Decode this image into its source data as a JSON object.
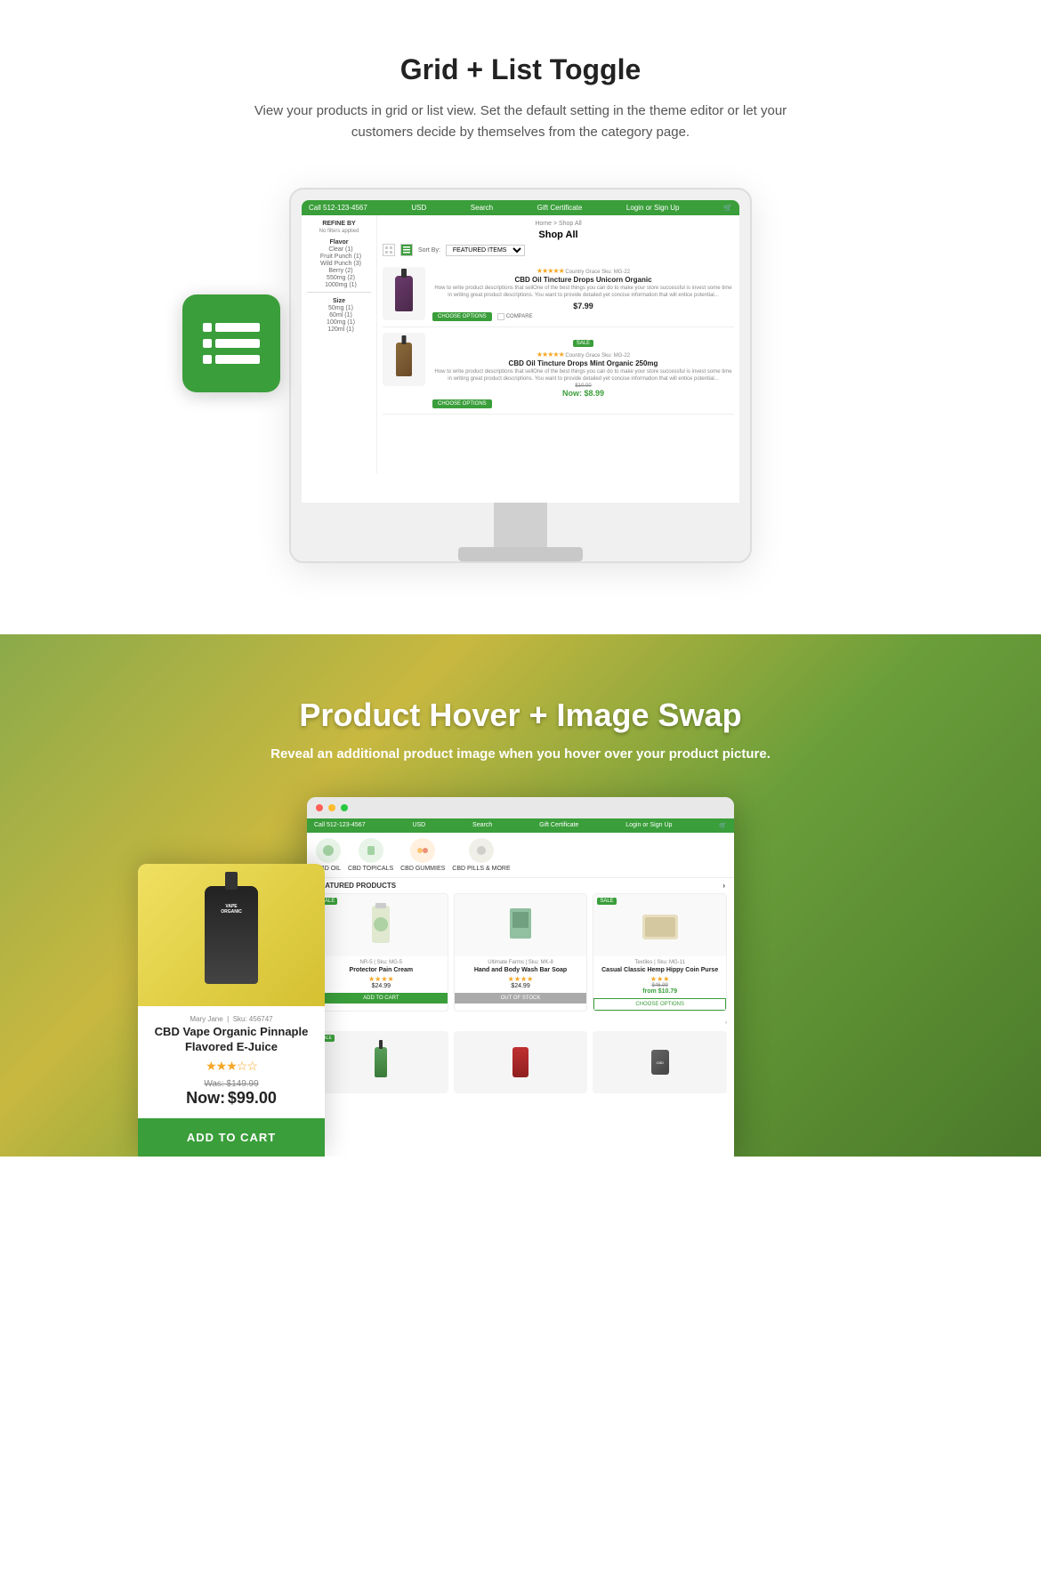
{
  "section1": {
    "title": "Grid + List Toggle",
    "description": "View your products in grid or list view. Set the default setting in the theme editor or let your customers decide by themselves from the category page.",
    "list_icon_rows": [
      "row1",
      "row2",
      "row3"
    ],
    "store": {
      "nav": {
        "phone": "Call 512-123-4567",
        "currency": "USD",
        "search": "Search",
        "gift": "Gift Certificate",
        "login": "Login or Sign Up"
      },
      "breadcrumb": "Home > Shop All",
      "shop_title": "Shop All",
      "sort_label": "Sort By:",
      "sort_value": "FEATURED ITEMS",
      "sidebar": {
        "title": "REFINE BY",
        "no_filters": "No filters applied",
        "sections": [
          {
            "name": "Flavor",
            "items": [
              "Clear (1)",
              "Fruit Punch (1)",
              "(3)",
              "(2)",
              "550mg (2)",
              "1000mg (1)"
            ]
          },
          {
            "name": "Size",
            "items": [
              "50mg (1)",
              "60ml (1)",
              "100mg (1)",
              "120ml (1)"
            ]
          }
        ]
      },
      "products": [
        {
          "vendor": "Country Grace",
          "sku": "Sku: MG-22",
          "name": "CBD Oil Tincture Drops Unicorn Organic",
          "description": "How to write product descriptions that sellOne of the best things you can do to make your store successful is invest some time in writing great product descriptions. You want to provide detailed yet concise information that will entice potential...",
          "price": "$7.99",
          "stars": "★★★★★",
          "sale": false,
          "btn_label": "CHOOSE OPTIONS",
          "compare": "COMPARE"
        },
        {
          "vendor": "Country Grace",
          "sku": "Sku: MG-22",
          "name": "CBD Oil Tincture Drops Mint Organic 250mg",
          "description": "How to write product descriptions that sellOne of the best things you can do to make your store successful is invest some time in writing great product descriptions. You want to provide detailed yet concise information that will entice potential...",
          "was_price": "$10.00",
          "now_price": "Now: $8.99",
          "stars": "★★★★★",
          "sale": true,
          "btn_label": "CHOOSE OPTIONS"
        }
      ]
    }
  },
  "section2": {
    "title": "Product Hover + Image Swap",
    "subtitle": "Reveal an additional product image when you hover over your product picture.",
    "store": {
      "nav": {
        "phone": "Call 512-123-4567",
        "currency": "USD",
        "search": "Search",
        "gift": "Gift Certificate",
        "login": "Login or Sign Up"
      },
      "categories": [
        {
          "name": "CBD OIL"
        },
        {
          "name": "CBD TOPICALS"
        },
        {
          "name": "CBD GUMMIES"
        },
        {
          "name": "CBD PILLS & MORE"
        }
      ],
      "featured_label": "FEATURED PRODUCTS",
      "products": [
        {
          "sale": true,
          "name": "Protector Pain Cream",
          "vendor": "NR-5",
          "sku": "Sku: MG-5",
          "stars": "★★★★",
          "price": "$24.99",
          "btn": "ADD TO CART"
        },
        {
          "sale": false,
          "name": "Hand and Body Wash Bar Soap",
          "vendor": "Ultimate Farms",
          "sku": "Sku: MK-8",
          "stars": "★★★★",
          "price": "$24.99",
          "btn": "OUT OF STOCK"
        },
        {
          "sale": true,
          "name": "Casual Classic Hemp Hippy Coin Purse",
          "vendor": "Textiles",
          "sku": "Sku: MG-11",
          "stars": "★★★",
          "was_price": "$46.99",
          "now_price": "from $10.79",
          "btn": "CHOOSE OPTIONS"
        }
      ]
    },
    "overlay_product": {
      "vendor": "Mary Jane",
      "sku": "Sku: 456747",
      "name": "CBD Vape Organic Pinnaple Flavored E-Juice",
      "stars": "★★★☆☆",
      "was_price": "Was: $149.99",
      "now_label": "Now:",
      "now_price": "$99.00",
      "add_to_cart": "ADD TO CART"
    },
    "bottom_products": [
      {
        "sale": true
      },
      {
        "sale": false
      },
      {
        "sale": false
      }
    ]
  }
}
